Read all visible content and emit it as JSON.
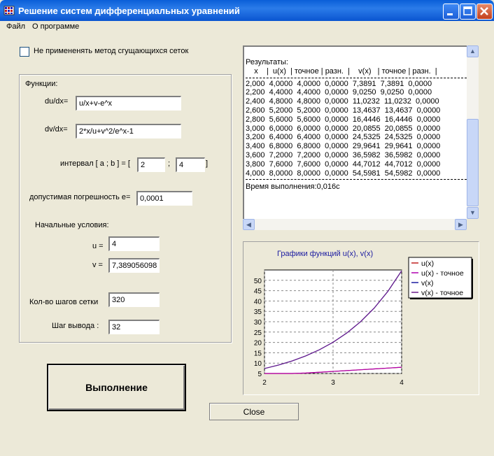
{
  "window": {
    "title": "Решение систем дифференциальных уравнений",
    "icon": "app-grid-icon"
  },
  "menu": {
    "file": "Файл",
    "about": "О программе"
  },
  "options": {
    "nonuniform_grid_label": "Не примененять  метод сгущающихся сеток",
    "nonuniform_grid_checked": false
  },
  "functions": {
    "group_label": "Функции:",
    "du_label": "du/dx=",
    "du_value": "u/x+v-e^x",
    "dv_label": "dv/dx=",
    "dv_value": "2*x/u+v^2/e^x-1",
    "interval_label": "интервал   [ a ; b ] = [",
    "interval_a": "2",
    "interval_sep": ";",
    "interval_b": "4",
    "interval_close": "]",
    "tolerance_label": "допустимая погрешность e=",
    "tolerance_value": "0,0001",
    "initial_label": "Начальные условия:",
    "u_label": "u =",
    "u_value": "4",
    "v_label": "v =",
    "v_value": "7,389056098",
    "steps_label": "Кол-во шагов сетки",
    "steps_value": "320",
    "output_step_label": "Шаг вывода :",
    "output_step_value": "32"
  },
  "results": {
    "title": "Результаты:",
    "header": "    x    |  u(x)  | точное | разн.  |    v(x)   | точное | разн.  |",
    "rows": [
      "2,000  4,0000  4,0000  0,0000  7,3891  7,3891  0,0000",
      "2,200  4,4000  4,4000  0,0000  9,0250  9,0250  0,0000",
      "2,400  4,8000  4,8000  0,0000  11,0232  11,0232  0,0000",
      "2,600  5,2000  5,2000  0,0000  13,4637  13,4637  0,0000",
      "2,800  5,6000  5,6000  0,0000  16,4446  16,4446  0,0000",
      "3,000  6,0000  6,0000  0,0000  20,0855  20,0855  0,0000",
      "3,200  6,4000  6,4000  0,0000  24,5325  24,5325  0,0000",
      "3,400  6,8000  6,8000  0,0000  29,9641  29,9641  0,0000",
      "3,600  7,2000  7,2000  0,0000  36,5982  36,5982  0,0000",
      "3,800  7,6000  7,6000  0,0000  44,7012  44,7012  0,0000",
      "4,000  8,0000  8,0000  0,0000  54,5981  54,5982  0,0000"
    ],
    "elapsed": "Время выполнения:0,016с"
  },
  "buttons": {
    "execute": "Выполнение",
    "close": "Close"
  },
  "colors": {
    "u": "#c02020",
    "u_exact": "#b000b0",
    "v": "#1c1ca0",
    "v_exact": "#6a1c8c",
    "title": "#1a1aa0"
  },
  "chart_data": {
    "type": "line",
    "title": "Графики функций u(x), v(x)",
    "xlim": [
      2,
      4
    ],
    "ylim": [
      5,
      55
    ],
    "x_ticks": [
      2,
      3,
      4
    ],
    "y_ticks": [
      5,
      10,
      15,
      20,
      25,
      30,
      35,
      40,
      45,
      50
    ],
    "grid": true,
    "legend_position": "top-right",
    "x": [
      2.0,
      2.2,
      2.4,
      2.6,
      2.8,
      3.0,
      3.2,
      3.4,
      3.6,
      3.8,
      4.0
    ],
    "series": [
      {
        "name": "u(x)",
        "values": [
          4.0,
          4.4,
          4.8,
          5.2,
          5.6,
          6.0,
          6.4,
          6.8,
          7.2,
          7.6,
          8.0
        ]
      },
      {
        "name": "u(x) - точное",
        "values": [
          4.0,
          4.4,
          4.8,
          5.2,
          5.6,
          6.0,
          6.4,
          6.8,
          7.2,
          7.6,
          8.0
        ]
      },
      {
        "name": "v(x)",
        "values": [
          7.3891,
          9.025,
          11.0232,
          13.4637,
          16.4446,
          20.0855,
          24.5325,
          29.9641,
          36.5982,
          44.7012,
          54.5981
        ]
      },
      {
        "name": "v(x) - точное",
        "values": [
          7.3891,
          9.025,
          11.0232,
          13.4637,
          16.4446,
          20.0855,
          24.5325,
          29.9641,
          36.5982,
          44.7012,
          54.5982
        ]
      }
    ]
  }
}
